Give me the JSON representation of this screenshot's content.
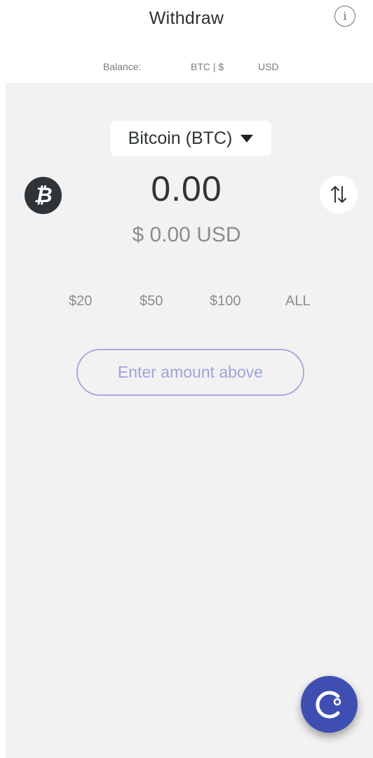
{
  "header": {
    "title": "Withdraw",
    "info_icon": "info-icon",
    "info_glyph": "i"
  },
  "balance": {
    "label": "Balance:",
    "btc_sep": "BTC | $",
    "usd": "USD"
  },
  "currency": {
    "selected": "Bitcoin (BTC)",
    "icon": "bitcoin-icon",
    "icon_glyph": "₿"
  },
  "amount": {
    "value": "0.00",
    "fiat": "$ 0.00 USD"
  },
  "swap_icon": "swap-vertical-icon",
  "quick_amounts": [
    "$20",
    "$50",
    "$100",
    "ALL"
  ],
  "submit": {
    "label": "Enter amount above"
  },
  "fab_icon": "celsius-logo-icon",
  "colors": {
    "accent": "#3f4fb1",
    "button_border": "#a9aedb",
    "button_text": "#9ea4d9",
    "background": "#f2f2f2"
  }
}
